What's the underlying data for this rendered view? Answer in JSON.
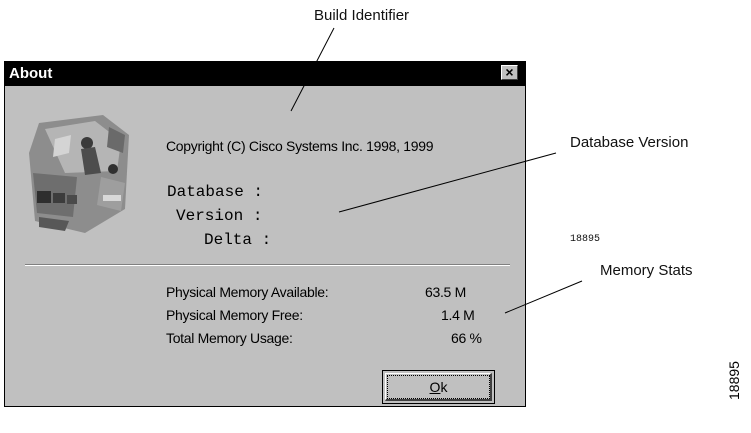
{
  "callouts": {
    "build_identifier": "Build Identifier",
    "database_version": "Database Version",
    "memory_stats": "Memory Stats",
    "build_number": "18895"
  },
  "dialog": {
    "title": "About",
    "close_glyph": "×",
    "copyright": "Copyright (C) Cisco Systems Inc. 1998, 1999",
    "database_label": "Database :",
    "version_label": "Version :",
    "delta_label": "Delta :",
    "memory": [
      {
        "label": "Physical Memory Available:",
        "value": "63.5 M"
      },
      {
        "label": "Physical Memory Free:",
        "value": "1.4 M"
      },
      {
        "label": "Total Memory Usage:",
        "value": "66 %"
      }
    ],
    "ok_prefix": "O",
    "ok_rest": "k"
  },
  "figure_id": "18895",
  "icons": {
    "logo": "cisco-network-artwork-icon",
    "close": "close-icon"
  }
}
